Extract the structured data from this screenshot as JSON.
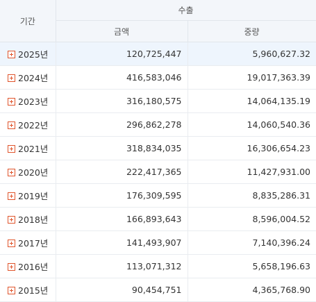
{
  "header": {
    "period_label": "기간",
    "group_label": "수출",
    "amount_label": "금액",
    "weight_label": "중량"
  },
  "rows": [
    {
      "year": "2025년",
      "amount": "120,725,447",
      "weight": "5,960,627.32"
    },
    {
      "year": "2024년",
      "amount": "416,583,046",
      "weight": "19,017,363.39"
    },
    {
      "year": "2023년",
      "amount": "316,180,575",
      "weight": "14,064,135.19"
    },
    {
      "year": "2022년",
      "amount": "296,862,278",
      "weight": "14,060,540.36"
    },
    {
      "year": "2021년",
      "amount": "318,834,035",
      "weight": "16,306,654.23"
    },
    {
      "year": "2020년",
      "amount": "222,417,365",
      "weight": "11,427,931.00"
    },
    {
      "year": "2019년",
      "amount": "176,309,595",
      "weight": "8,835,286.31"
    },
    {
      "year": "2018년",
      "amount": "166,893,643",
      "weight": "8,596,004.52"
    },
    {
      "year": "2017년",
      "amount": "141,493,907",
      "weight": "7,140,396.24"
    },
    {
      "year": "2016년",
      "amount": "113,071,312",
      "weight": "5,658,196.63"
    },
    {
      "year": "2015년",
      "amount": "90,454,751",
      "weight": "4,365,768.90"
    }
  ],
  "colors": {
    "header_bg": "#f3f6fa",
    "selected_row_bg": "#eef5fd",
    "expand_icon": "#e0542b"
  }
}
